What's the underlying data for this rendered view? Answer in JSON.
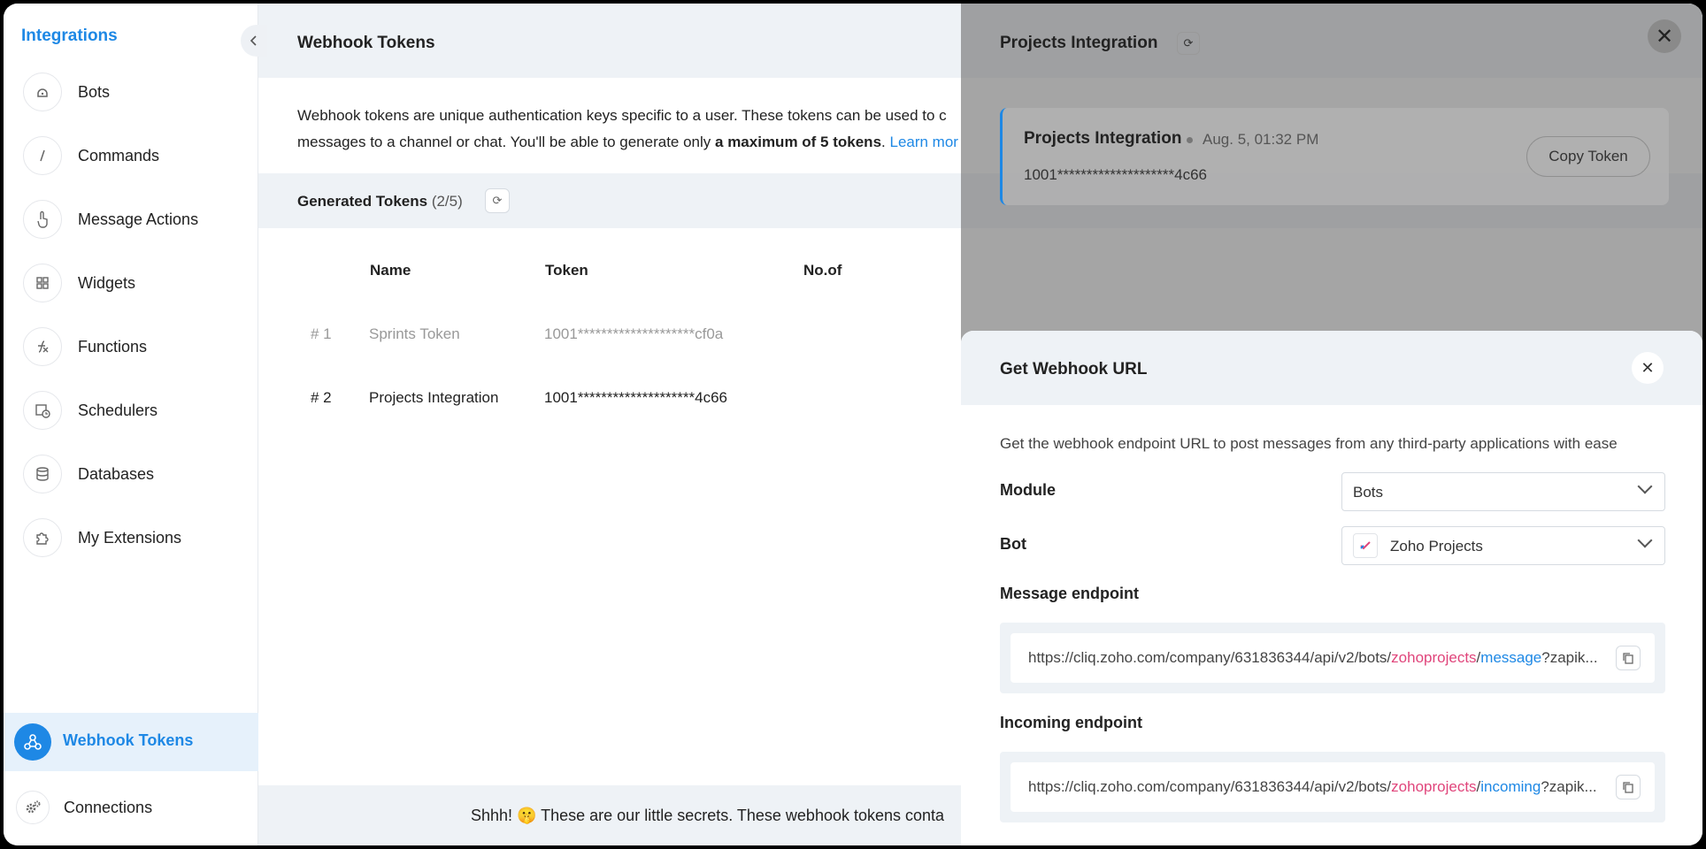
{
  "sidebar": {
    "title": "Integrations",
    "items": [
      {
        "label": "Bots",
        "icon": "bot-icon"
      },
      {
        "label": "Commands",
        "icon": "slash-icon"
      },
      {
        "label": "Message Actions",
        "icon": "hand-pointer-icon"
      },
      {
        "label": "Widgets",
        "icon": "grid-icon"
      },
      {
        "label": "Functions",
        "icon": "function-icon"
      },
      {
        "label": "Schedulers",
        "icon": "calendar-clock-icon"
      },
      {
        "label": "Databases",
        "icon": "database-icon"
      },
      {
        "label": "My Extensions",
        "icon": "puzzle-icon"
      }
    ],
    "active": {
      "label": "Webhook Tokens",
      "icon": "webhook-icon"
    },
    "connections": {
      "label": "Connections",
      "icon": "gears-icon"
    }
  },
  "main": {
    "title": "Webhook Tokens",
    "description_part1": "Webhook tokens are unique authentication keys specific to a user. These tokens can be used to c",
    "description_part2": "messages to a channel or chat. You'll be able to generate only ",
    "description_bold": "a maximum of 5 tokens",
    "description_part3": ". ",
    "learn_more": "Learn mor",
    "generated_title": "Generated Tokens",
    "generated_count": "(2/5)",
    "columns": {
      "name": "Name",
      "token": "Token",
      "count": "No.of"
    },
    "rows": [
      {
        "num": "# 1",
        "name": "Sprints Token",
        "token": "1001********************cf0a"
      },
      {
        "num": "# 2",
        "name": "Projects Integration",
        "token": "1001********************4c66"
      }
    ],
    "footer_text": "Shhh! 🤫 These are our little secrets. These webhook tokens conta"
  },
  "panel": {
    "title": "Projects Integration",
    "close": "✕",
    "token_card": {
      "name": "Projects Integration",
      "date": "Aug. 5, 01:32 PM",
      "value": "1001********************4c66",
      "copy_label": "Copy Token"
    }
  },
  "modal": {
    "title": "Get Webhook URL",
    "close": "✕",
    "subtitle": "Get the webhook endpoint URL to post messages from any third-party applications with ease",
    "module_label": "Module",
    "module_value": "Bots",
    "bot_label": "Bot",
    "bot_value": "Zoho Projects",
    "message_label": "Message endpoint",
    "message_url_base": "https://cliq.zoho.com/company/631836344/api/v2/bots/",
    "message_url_bot": "zohoprojects",
    "message_url_slash": "/",
    "message_url_type": "message",
    "message_url_rest": "?zapik...",
    "incoming_label": "Incoming endpoint",
    "incoming_url_base": "https://cliq.zoho.com/company/631836344/api/v2/bots/",
    "incoming_url_bot": "zohoprojects",
    "incoming_url_slash": "/",
    "incoming_url_type": "incoming",
    "incoming_url_rest": "?zapik..."
  },
  "colors": {
    "accent": "#1e88e5",
    "pink": "#e0457b"
  }
}
